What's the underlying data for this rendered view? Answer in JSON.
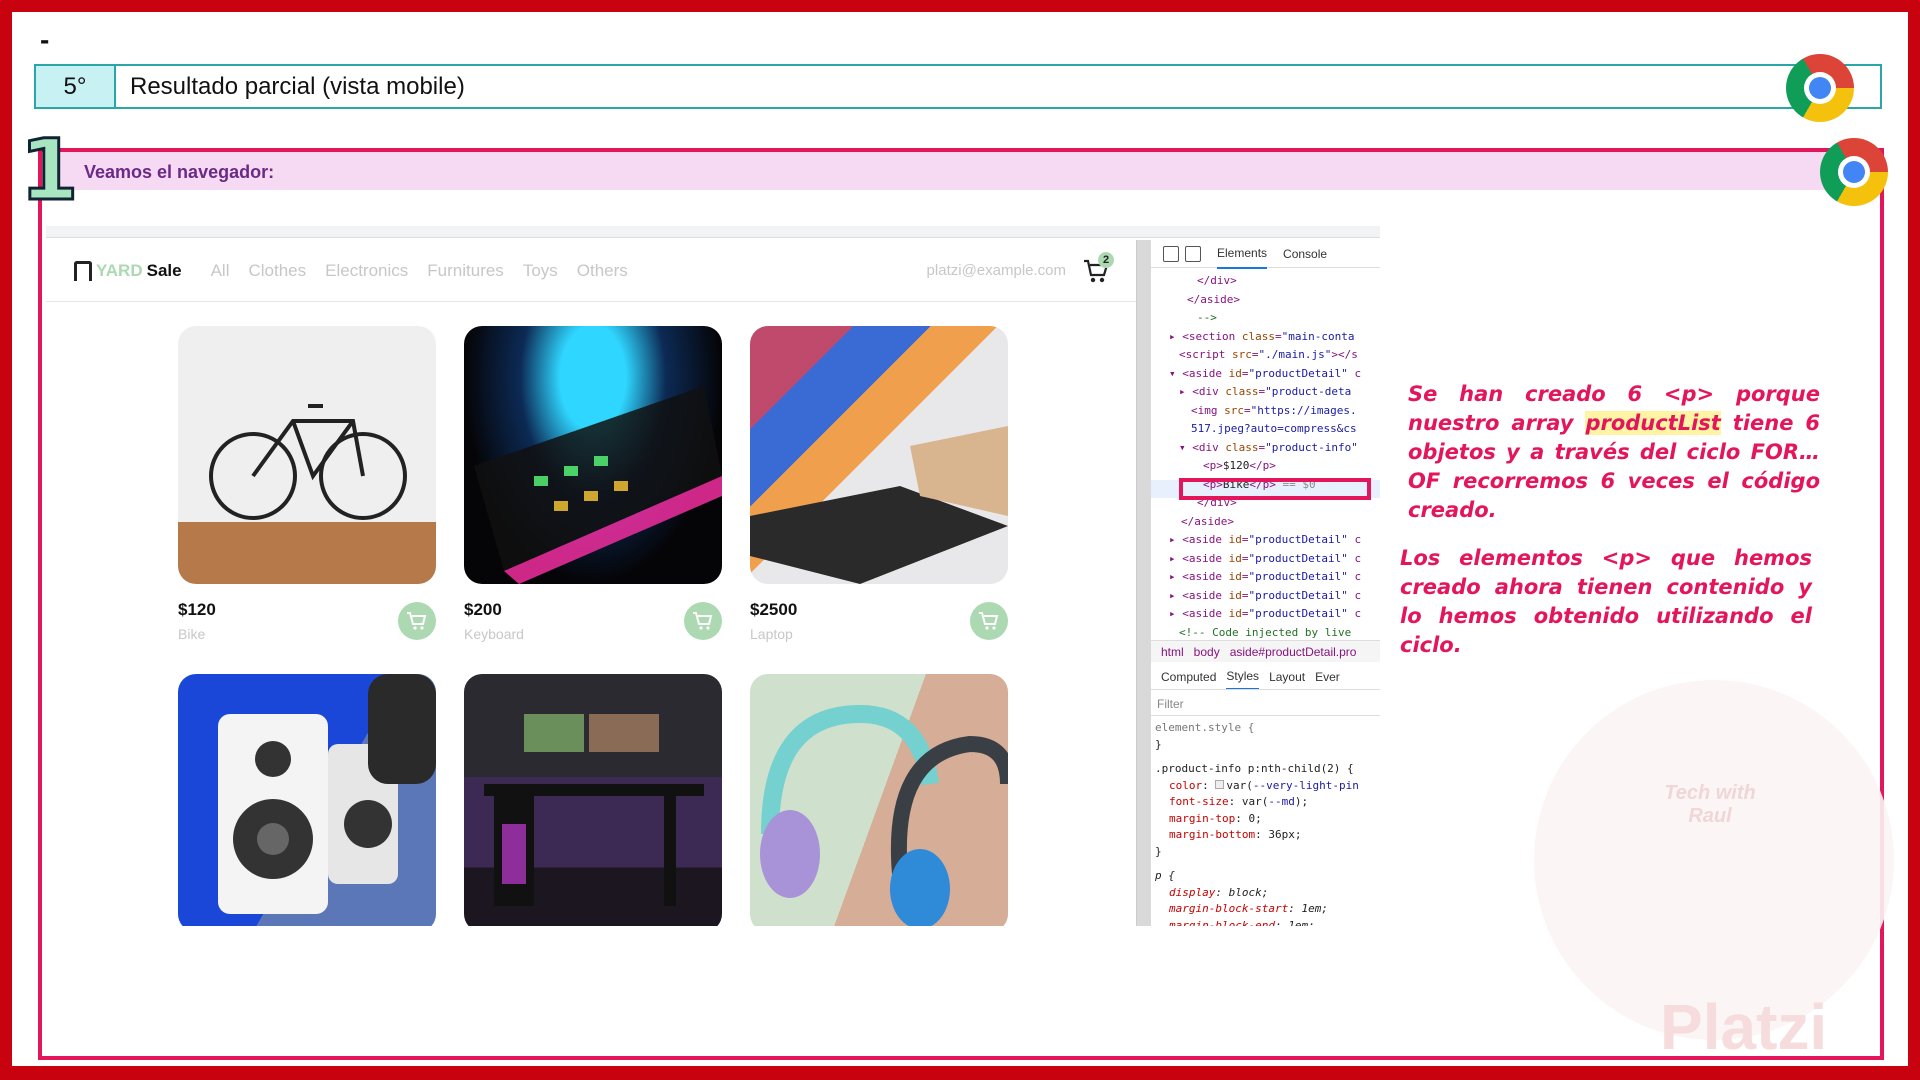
{
  "slide": {
    "dash": "-",
    "step_number": "5°",
    "step_title": "Resultado parcial (vista mobile)",
    "section_number": "1",
    "section_label": "Veamos el navegador:"
  },
  "app": {
    "address": "",
    "logo_yard": "YARD",
    "logo_sale": "Sale",
    "nav_links": [
      "All",
      "Clothes",
      "Electronics",
      "Furnitures",
      "Toys",
      "Others"
    ],
    "email": "platzi@example.com",
    "cart_count": "2",
    "products": [
      {
        "price": "$120",
        "name": "Bike",
        "image": "bike"
      },
      {
        "price": "$200",
        "name": "Keyboard",
        "image": "keyboard"
      },
      {
        "price": "$2500",
        "name": "Laptop",
        "image": "laptop"
      },
      {
        "price": "",
        "name": "",
        "image": "speakers"
      },
      {
        "price": "",
        "name": "",
        "image": "desk"
      },
      {
        "price": "",
        "name": "",
        "image": "headphones"
      }
    ]
  },
  "devtools": {
    "tabs": [
      "Elements",
      "Console"
    ],
    "active_tab": "Elements",
    "breadcrumbs": [
      "html",
      "body",
      "aside#productDetail.pro"
    ],
    "style_tabs": [
      "Computed",
      "Styles",
      "Layout",
      "Ever"
    ],
    "active_style_tab": "Styles",
    "filter_placeholder": "Filter"
  },
  "notes": {
    "note1_before": "Se han creado 6 <p> porque nuestro array ",
    "note1_keyword": "productList",
    "note1_after": " tiene 6 objetos y a través del ciclo FOR…OF recorremos 6 veces el código creado.",
    "note2": "Los elementos <p> que hemos creado ahora tienen contenido y lo hemos obtenido utilizando el ciclo."
  },
  "watermark": {
    "brand": "Platzi",
    "small_text": "Tech with Raul"
  },
  "colors": {
    "frame_red": "#c8020f",
    "accent_pink": "#e3165b",
    "brand_green": "#acd9b2",
    "teal": "#2aa6a6"
  },
  "icons": [
    "chrome-icon",
    "cart-icon",
    "add-to-cart-icon",
    "inspect-icon",
    "device-toolbar-icon"
  ]
}
